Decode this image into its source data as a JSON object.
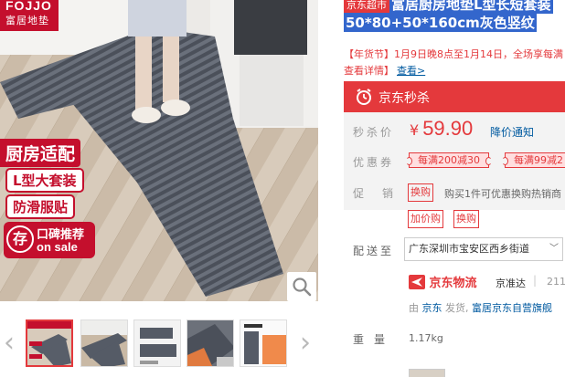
{
  "brand": {
    "logo_line1": "FOJJO",
    "logo_line2": "富居地垫"
  },
  "main_image": {
    "promo_tag": "厨房适配",
    "features": [
      "L型大套装",
      "防滑服贴"
    ],
    "word_badge": {
      "seal": "存",
      "line1": "口碑推荐",
      "line2": "on sale"
    },
    "zoom_icon": "magnifier-icon"
  },
  "thumbnails": {
    "prev_icon": "chevron-left-icon",
    "next_icon": "chevron-right-icon",
    "count": 5,
    "active_index": 0
  },
  "product": {
    "self_op_tag": "京东超市",
    "title_line1": "富居厨房地垫L型长短套装",
    "title_line2": "50*80+50*160cm灰色竖纹",
    "promo_text": "【年货节】1月9日晚8点至1月14日，全场享每满",
    "promo_link_prefix": "查看详情】",
    "promo_link": "查看>"
  },
  "seckill": {
    "label": "京东秒杀",
    "icon": "alarm-clock-icon"
  },
  "summary": {
    "price_label": "秒杀价",
    "currency": "¥",
    "price": "59.90",
    "price_notify": "降价通知",
    "coupon_label": "优惠券",
    "coupons": [
      "每满200减30",
      "每满99减2"
    ],
    "promo_label": "促销",
    "promo_tags": [
      "换购",
      "加价购",
      "换购"
    ],
    "promo_desc": "购买1件可优惠换购热销商"
  },
  "shipping": {
    "label": "配送至",
    "address": "广东深圳市宝安区西乡街道",
    "chevron_icon": "chevron-down-icon",
    "logistics_name": "京东物流",
    "logistics_icon": "jd-logistics-plane-icon",
    "logistics_service": "京准达",
    "logistics_extra": "211",
    "from_prefix": "由",
    "from_seller": "京东",
    "from_mid": "发货,",
    "from_store": "富居京东自营旗舰"
  },
  "weight": {
    "label": "重量",
    "value": "1.17kg"
  },
  "colors": {
    "jd_red": "#e4393c",
    "brand_red": "#c40f2d",
    "title_highlight": "#3366cc",
    "link_blue": "#005aa0"
  }
}
